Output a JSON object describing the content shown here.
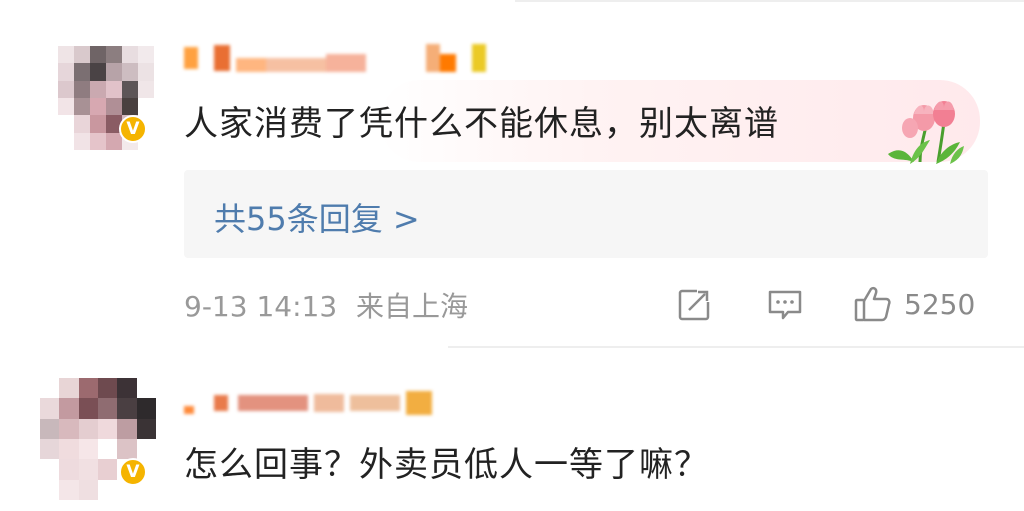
{
  "comments": [
    {
      "username": "",
      "text": "人家消费了凭什么不能休息，别太离谱",
      "verified_badge": "V",
      "reply_link": "共55条回复 >",
      "timestamp": "9-13 14:13",
      "location": "来自上海",
      "like_count": "5250",
      "icons": [
        "share-icon",
        "comment-icon",
        "like-icon"
      ]
    },
    {
      "username": "",
      "text": "怎么回事？外卖员低人一等了嘛？",
      "verified_badge": "V"
    }
  ],
  "colors": {
    "badge": "#f5b400",
    "username": "#ff8200",
    "reply_link": "#4f7cad",
    "meta": "#999999"
  }
}
